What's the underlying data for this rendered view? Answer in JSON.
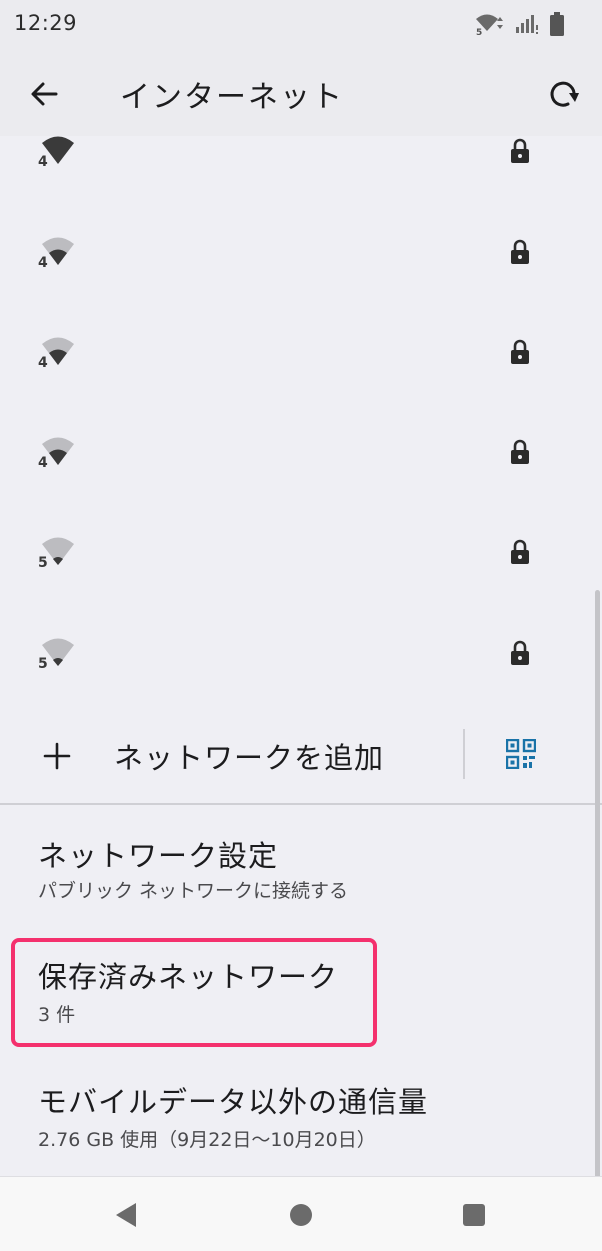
{
  "status_bar": {
    "time": "12:29",
    "wifi_band": "5",
    "icons": [
      "wifi-icon",
      "signal-icon",
      "battery-icon"
    ]
  },
  "app_bar": {
    "title": "インターネット",
    "back_icon": "arrow-back-icon",
    "refresh_icon": "refresh-icon"
  },
  "networks": [
    {
      "band": "4",
      "ssid": "",
      "secured": true
    },
    {
      "band": "4",
      "ssid": "",
      "secured": true
    },
    {
      "band": "4",
      "ssid": "",
      "secured": true
    },
    {
      "band": "4",
      "ssid": "",
      "secured": true
    },
    {
      "band": "5",
      "ssid": "",
      "secured": true
    },
    {
      "band": "5",
      "ssid": "",
      "secured": true
    }
  ],
  "add_network": {
    "label": "ネットワークを追加",
    "qr_icon": "qr-code-scanner-icon"
  },
  "settings": {
    "network_settings": {
      "title": "ネットワーク設定",
      "subtitle": "パブリック ネットワークに接続する"
    },
    "saved_networks": {
      "title": "保存済みネットワーク",
      "subtitle": "3 件"
    },
    "data_usage": {
      "title": "モバイルデータ以外の通信量",
      "subtitle": "2.76 GB 使用（9月22日〜10月20日）"
    }
  },
  "colors": {
    "accent": "#1a73a8",
    "highlight": "#f4306d",
    "background": "#efeff4"
  }
}
